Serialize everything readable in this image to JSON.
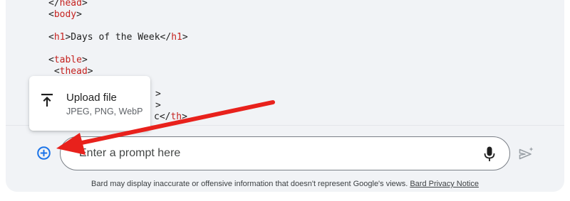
{
  "code": {
    "lines": [
      {
        "pre": "</",
        "tag": "head",
        "post": ">",
        "tail": "",
        "indent": ""
      },
      {
        "pre": "<",
        "tag": "body",
        "post": ">",
        "tail": "",
        "indent": ""
      },
      {
        "text_a": "<",
        "tag_a": "h1",
        "text_b": ">Days of the Week</",
        "tag_b": "h1",
        "text_c": ">"
      },
      {
        "pre": "<",
        "tag": "table",
        "post": ">",
        "tail": "",
        "indent": ""
      },
      {
        "pre": "<",
        "tag": "thead",
        "post": ">",
        "tail": "",
        "indent": " "
      },
      {
        "visible": ">"
      },
      {
        "visible": ">"
      },
      {
        "visible_a": "c</",
        "visible_tag": "th",
        "visible_b": ">"
      }
    ]
  },
  "upload_menu": {
    "title": "Upload file",
    "subtitle": "JPEG, PNG, WebP",
    "icon": "upload-icon"
  },
  "prompt": {
    "placeholder": "Enter a prompt here",
    "add_icon": "add-circle-icon",
    "mic_icon": "mic-icon",
    "send_icon": "send-icon"
  },
  "footer": {
    "disclaimer": "Bard may display inaccurate or offensive information that doesn't represent Google's views.",
    "privacy_link": "Bard Privacy Notice"
  },
  "colors": {
    "accent": "#1a73e8",
    "annotation_arrow": "#e8211c",
    "code_tag": "#c5221f"
  }
}
